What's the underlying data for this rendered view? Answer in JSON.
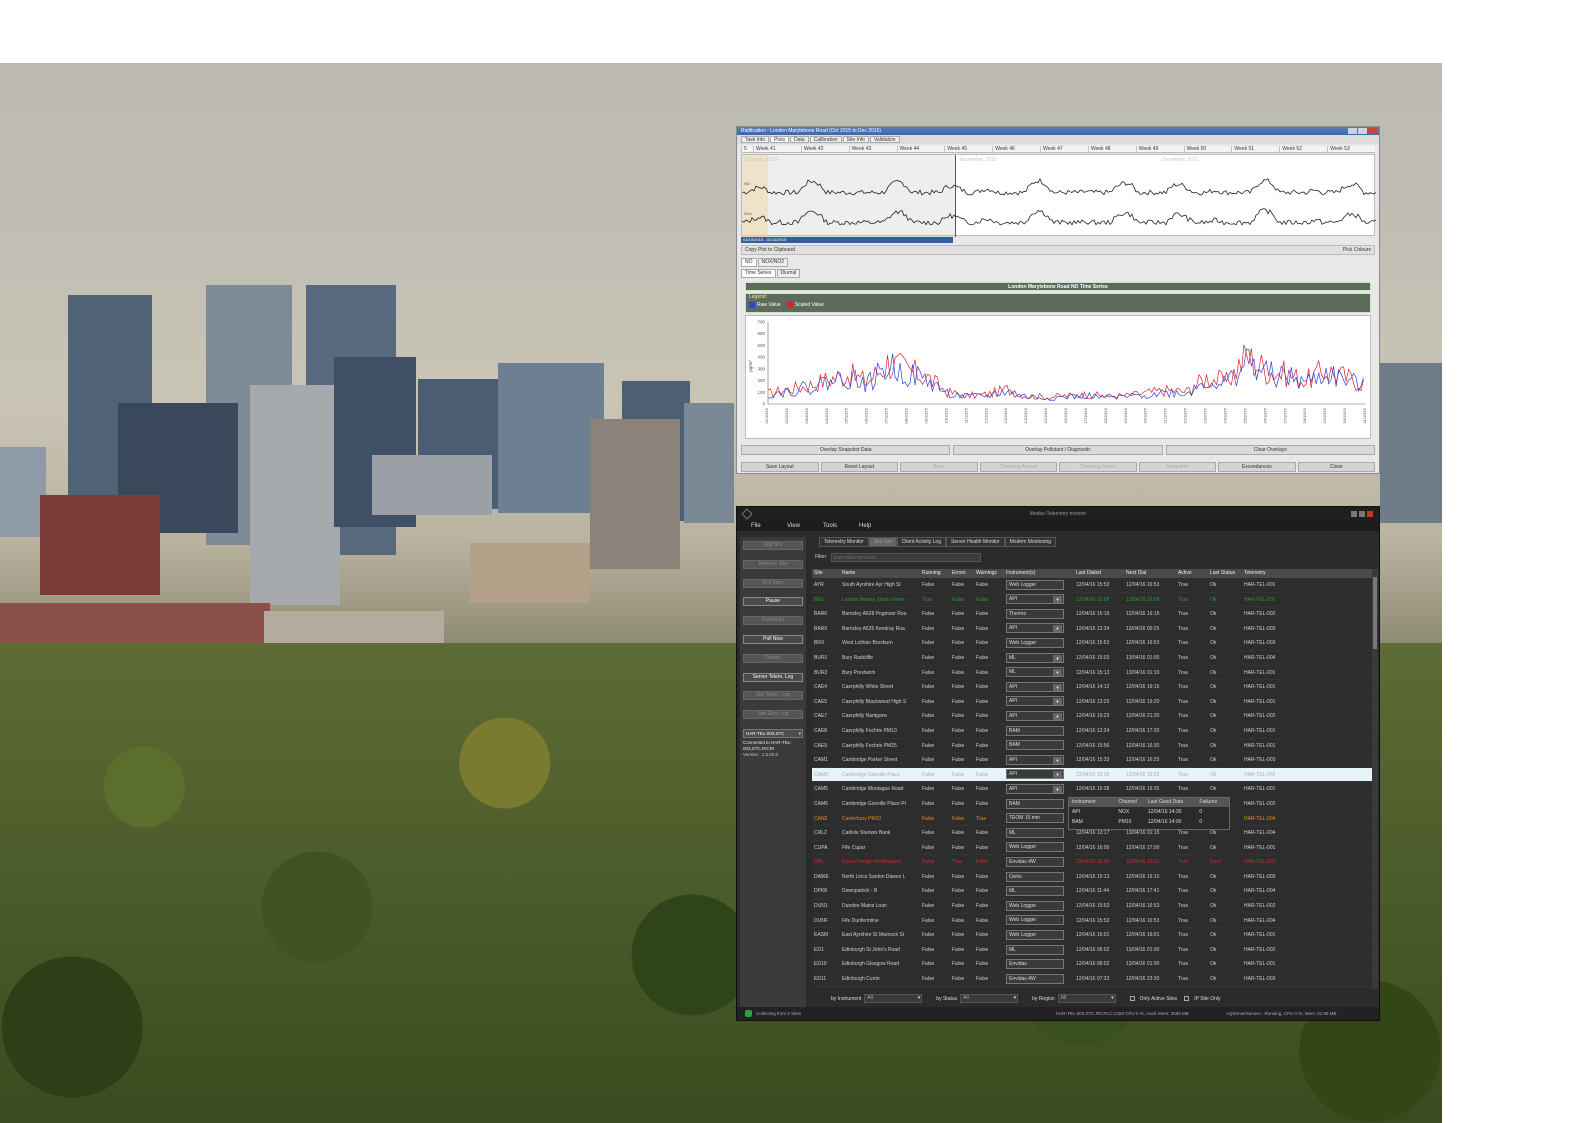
{
  "top_window": {
    "title": "Ratification - London Marylebone Road (Oct 2015 to Dec 2015)",
    "tabs": [
      "Task Info",
      "Plots",
      "Data",
      "Calibration",
      "Site Info",
      "Validation"
    ],
    "active_tab": "Plots",
    "weeks": [
      "Week 41",
      "Week 42",
      "Week 43",
      "Week 44",
      "Week 45",
      "Week 46",
      "Week 47",
      "Week 48",
      "Week 49",
      "Week 50",
      "Week 51",
      "Week 52",
      "Week 53"
    ],
    "week_start": "5",
    "months": [
      "October, 2015",
      "November, 2015",
      "December, 2015"
    ],
    "overview_labels": [
      "NO",
      "NOx"
    ],
    "selected_range": "01/10/2015 - 01/11/2015",
    "copy_plot": "Copy Plot to Clipboard",
    "pick_colours": "Pick Colours",
    "pollutant_tabs": [
      "NO",
      "NOX/NO2"
    ],
    "series_tabs": [
      "Time Series",
      "Diurnal"
    ],
    "chart_title": "London Marylebone Road NO Time Series",
    "legend_title": "Legend:",
    "legend_items": [
      {
        "name": "Raw Value",
        "color": "#2b46d6"
      },
      {
        "name": "Scaled Value",
        "color": "#e0202a"
      }
    ],
    "y_axis_label": "µg/m³",
    "buttons_row1": [
      "Overlay Snapshot Data",
      "Overlay Pollutant / Diagnostic",
      "Clear Overlays"
    ],
    "buttons_row2": [
      "Save Layout",
      "Reset Layout",
      "Save",
      "Checking Accept",
      "Checking Reject",
      "Snapshot",
      "Exceedances",
      "Close"
    ],
    "buttons_row2_disabled": [
      false,
      false,
      true,
      true,
      true,
      true,
      false,
      false
    ]
  },
  "chart_data": {
    "type": "line",
    "title": "London Marylebone Road NO Time Series",
    "ylabel": "µg/m³",
    "ylim": [
      0,
      700
    ],
    "y_ticks": [
      0,
      100,
      200,
      300,
      400,
      500,
      600,
      700
    ],
    "x": [
      "01/10/15",
      "02/10/15",
      "03/10/15",
      "04/10/15",
      "05/10/15",
      "06/10/15",
      "07/10/15",
      "08/10/15",
      "09/10/15",
      "10/10/15",
      "11/10/15",
      "12/10/15",
      "13/10/15",
      "14/10/15",
      "15/10/15",
      "16/10/15",
      "17/10/15",
      "18/10/15",
      "19/10/15",
      "20/10/15",
      "21/10/15",
      "22/10/15",
      "23/10/15",
      "24/10/15",
      "25/10/15",
      "26/10/15",
      "27/10/15",
      "28/10/15",
      "29/10/15",
      "30/10/15",
      "31/10/15"
    ],
    "series": [
      {
        "name": "Raw Value",
        "color": "#2b46d6",
        "values": [
          80,
          110,
          140,
          190,
          230,
          170,
          320,
          260,
          200,
          90,
          60,
          70,
          110,
          60,
          50,
          60,
          70,
          55,
          60,
          80,
          100,
          90,
          200,
          170,
          370,
          260,
          230,
          180,
          260,
          200,
          150
        ]
      },
      {
        "name": "Scaled Value",
        "color": "#e0202a",
        "values": [
          90,
          125,
          155,
          210,
          255,
          190,
          355,
          290,
          225,
          100,
          70,
          80,
          125,
          70,
          60,
          70,
          80,
          65,
          70,
          95,
          115,
          105,
          225,
          190,
          410,
          290,
          255,
          200,
          290,
          225,
          170
        ]
      }
    ]
  },
  "monitor": {
    "title": "Modus-Telemetry monitor",
    "menu": [
      "File",
      "View",
      "Tools",
      "Help"
    ],
    "side_buttons": [
      {
        "label": "Add Site",
        "enabled": false
      },
      {
        "label": "Remove Site",
        "enabled": false
      },
      {
        "label": "Poll Sites",
        "enabled": false
      },
      {
        "label": "Pause",
        "enabled": true
      },
      {
        "label": "Download",
        "enabled": false
      },
      {
        "label": "Poll Now",
        "enabled": true
      },
      {
        "label": "Details",
        "enabled": false
      },
      {
        "label": "Server Telem. Log",
        "enabled": true
      },
      {
        "label": "Site Telem. Log",
        "enabled": false
      },
      {
        "label": "Site Error Log",
        "enabled": false
      }
    ],
    "server_select": "HAR-TEL-003,STC",
    "connected_to": "Connected to HAR-TEL-003,STC,RICRr",
    "version": "Version : 1.3.20.0",
    "tabs": [
      "Telemetry Monitor",
      "Site List",
      "Client Activity Log",
      "Server Health Monitor",
      "Modem Monitoring"
    ],
    "active_tab": "Site List",
    "filter_label": "Filter:",
    "filter_placeholder": "Enter Filter Text Here",
    "columns": [
      "Site",
      "Name",
      "Running",
      "Errors",
      "Warnings",
      "Instrument(s)",
      "Last Dialed",
      "Next Dial",
      "Active",
      "Last Status",
      "Telemetry"
    ],
    "rows": [
      {
        "site": "AYR",
        "name": "South Ayrshire Ayr High St",
        "running": "False",
        "errors": "False",
        "warnings": "False",
        "instrument": "Web Logger",
        "last": "12/04/16 15:53",
        "next": "12/04/16 16:53",
        "active": "True",
        "status": "Ok",
        "tel": "HAR-TEL-001",
        "color": "#d0d0d0",
        "dd": false
      },
      {
        "site": "BEX",
        "name": "London Bexley Slade Green",
        "running": "True",
        "errors": "False",
        "warnings": "False",
        "instrument": "API",
        "last": "12/04/16 16:08",
        "next": "12/04/16 16:08",
        "active": "True",
        "status": "Ok",
        "tel": "HAR-TEL-001",
        "color": "#2e9b2e",
        "dd": true
      },
      {
        "site": "BAR6",
        "name": "Barnsley A628 Pogmoor Roa",
        "running": "False",
        "errors": "False",
        "warnings": "False",
        "instrument": "Thermo",
        "last": "12/04/16 15:16",
        "next": "12/04/16 16:15",
        "active": "True",
        "status": "Ok",
        "tel": "HAR-TEL-002",
        "color": "#d0d0d0",
        "dd": false
      },
      {
        "site": "BAR9",
        "name": "Barnsley A635 Kendray Roa",
        "running": "False",
        "errors": "False",
        "warnings": "False",
        "instrument": "API",
        "last": "12/04/16 12:34",
        "next": "13/04/16 00:25",
        "active": "True",
        "status": "Ok",
        "tel": "HAR-TEL-003",
        "color": "#d0d0d0",
        "dd": true
      },
      {
        "site": "BRX",
        "name": "West Lothian Broxburn",
        "running": "False",
        "errors": "False",
        "warnings": "False",
        "instrument": "Web Logger",
        "last": "12/04/16 15:53",
        "next": "12/04/16 16:53",
        "active": "True",
        "status": "Ok",
        "tel": "HAR-TEL-003",
        "color": "#d0d0d0",
        "dd": false
      },
      {
        "site": "BUR1",
        "name": "Bury Radcliffe",
        "running": "False",
        "errors": "False",
        "warnings": "False",
        "instrument": "ML",
        "last": "12/04/16 15:03",
        "next": "13/04/16 01:00",
        "active": "True",
        "status": "Ok",
        "tel": "HAR-TEL-004",
        "color": "#d0d0d0",
        "dd": true
      },
      {
        "site": "BUR2",
        "name": "Bury Prestwich",
        "running": "False",
        "errors": "False",
        "warnings": "False",
        "instrument": "ML",
        "last": "12/04/16 15:13",
        "next": "13/04/16 01:10",
        "active": "True",
        "status": "Ok",
        "tel": "HAR-TEL-001",
        "color": "#d0d0d0",
        "dd": true
      },
      {
        "site": "CAE4",
        "name": "Caerphilly White Street",
        "running": "False",
        "errors": "False",
        "warnings": "False",
        "instrument": "API",
        "last": "12/04/16 14:12",
        "next": "12/04/16 19:15",
        "active": "True",
        "status": "Ok",
        "tel": "HAR-TEL-001",
        "color": "#d0d0d0",
        "dd": true
      },
      {
        "site": "CAE5",
        "name": "Caerphilly Blackwood High S",
        "running": "False",
        "errors": "False",
        "warnings": "False",
        "instrument": "API",
        "last": "12/04/16 13:25",
        "next": "12/04/16 19:20",
        "active": "True",
        "status": "Ok",
        "tel": "HAR-TEL-001",
        "color": "#d0d0d0",
        "dd": true
      },
      {
        "site": "CAE7",
        "name": "Caerphilly Nantgarw",
        "running": "False",
        "errors": "False",
        "warnings": "False",
        "instrument": "API",
        "last": "12/04/16 10:23",
        "next": "12/04/16 21:20",
        "active": "True",
        "status": "Ok",
        "tel": "HAR-TEL-002",
        "color": "#d0d0d0",
        "dd": true
      },
      {
        "site": "CAE8",
        "name": "Caerphilly Fochrie PM10",
        "running": "False",
        "errors": "False",
        "warnings": "False",
        "instrument": "BAM",
        "last": "12/04/16 12:24",
        "next": "12/04/16 17:20",
        "active": "True",
        "status": "Ok",
        "tel": "HAR-TEL-001",
        "color": "#d0d0d0",
        "dd": false
      },
      {
        "site": "CAE9",
        "name": "Caerphilly Fochrie PM25",
        "running": "False",
        "errors": "False",
        "warnings": "False",
        "instrument": "BAM",
        "last": "12/04/16 15:56",
        "next": "12/04/16 16:30",
        "active": "True",
        "status": "Ok",
        "tel": "HAR-TEL-001",
        "color": "#d0d0d0",
        "dd": false
      },
      {
        "site": "CAM1",
        "name": "Cambridge Parker Street",
        "running": "False",
        "errors": "False",
        "warnings": "False",
        "instrument": "API",
        "last": "12/04/16 15:33",
        "next": "12/04/16 16:25",
        "active": "True",
        "status": "Ok",
        "tel": "HAR-TEL-003",
        "color": "#d0d0d0",
        "dd": true
      },
      {
        "site": "CAM3",
        "name": "Cambridge Gonville Place",
        "running": "False",
        "errors": "False",
        "warnings": "False",
        "instrument": "API",
        "last": "12/04/16 15:35",
        "next": "12/04/16 16:25",
        "active": "True",
        "status": "Ok",
        "tel": "HAR-TEL-002",
        "color": "#aab",
        "dd": true,
        "hl": true
      },
      {
        "site": "CAM5",
        "name": "Cambridge Montague Road",
        "running": "False",
        "errors": "False",
        "warnings": "False",
        "instrument": "API",
        "last": "12/04/16 15:38",
        "next": "12/04/16 16:35",
        "active": "True",
        "status": "Ok",
        "tel": "HAR-TEL-001",
        "color": "#d0d0d0",
        "dd": true
      },
      {
        "site": "CAM6",
        "name": "Cambridge Gonville Place PI",
        "running": "False",
        "errors": "False",
        "warnings": "False",
        "instrument": "BAM",
        "last": "",
        "next": "",
        "active": "",
        "status": "",
        "tel": "HAR-TEL-002",
        "color": "#d0d0d0",
        "dd": false
      },
      {
        "site": "CAN2",
        "name": "Canterbury PM10",
        "running": "False",
        "errors": "False",
        "warnings": "True",
        "instrument": "TEOM 15 min",
        "last": "",
        "next": "",
        "active": "",
        "status": "ng",
        "tel": "HAR-TEL-004",
        "color": "#e8921c",
        "dd": false
      },
      {
        "site": "CRL2",
        "name": "Carlisle Stanwix Bank",
        "running": "False",
        "errors": "False",
        "warnings": "False",
        "instrument": "ML",
        "last": "12/04/16 12:17",
        "next": "13/04/16 01:15",
        "active": "True",
        "status": "Ok",
        "tel": "HAR-TEL-004",
        "color": "#d0d0d0",
        "dd": false
      },
      {
        "site": "CUPA",
        "name": "Fife Cupar",
        "running": "False",
        "errors": "False",
        "warnings": "False",
        "instrument": "Web Logger",
        "last": "12/04/16 16:00",
        "next": "12/04/16 17:00",
        "active": "True",
        "status": "Ok",
        "tel": "HAR-TEL-001",
        "color": "#d0d0d0",
        "dd": false
      },
      {
        "site": "DAL",
        "name": "Essex Dengie Rd Mayland",
        "running": "False",
        "errors": "True",
        "warnings": "False",
        "instrument": "Envidas 4W",
        "last": "12/04/16 15:00",
        "next": "12/04/16 16:02",
        "active": "True",
        "status": "Error",
        "tel": "HAR-TEL-001",
        "color": "#d42a2a",
        "dd": false
      },
      {
        "site": "DAWE",
        "name": "North Lincs Santon Dawes L",
        "running": "False",
        "errors": "False",
        "warnings": "False",
        "instrument": "Osiris",
        "last": "12/04/16 15:13",
        "next": "12/04/16 16:10",
        "active": "True",
        "status": "Ok",
        "tel": "HAR-TEL-003",
        "color": "#d0d0d0",
        "dd": false
      },
      {
        "site": "DPK8",
        "name": "Downpatrick - B",
        "running": "False",
        "errors": "False",
        "warnings": "False",
        "instrument": "ML",
        "last": "12/04/16 11:44",
        "next": "12/04/16 17:41",
        "active": "True",
        "status": "Ok",
        "tel": "HAR-TEL-004",
        "color": "#d0d0d0",
        "dd": false
      },
      {
        "site": "DUN1",
        "name": "Dundee Mains Loan",
        "running": "False",
        "errors": "False",
        "warnings": "False",
        "instrument": "Web Logger",
        "last": "12/04/16 15:53",
        "next": "12/04/16 16:53",
        "active": "True",
        "status": "Ok",
        "tel": "HAR-TEL-002",
        "color": "#d0d0d0",
        "dd": false
      },
      {
        "site": "DUNF",
        "name": "Fife Dunfermline",
        "running": "False",
        "errors": "False",
        "warnings": "False",
        "instrument": "Web Logger",
        "last": "12/04/16 15:53",
        "next": "12/04/16 16:53",
        "active": "True",
        "status": "Ok",
        "tel": "HAR-TEL-004",
        "color": "#d0d0d0",
        "dd": false
      },
      {
        "site": "EASM",
        "name": "East Ayrshire St Marnock St",
        "running": "False",
        "errors": "False",
        "warnings": "False",
        "instrument": "Web Logger",
        "last": "12/04/16 15:01",
        "next": "12/04/16 16:01",
        "active": "True",
        "status": "Ok",
        "tel": "HAR-TEL-001",
        "color": "#d0d0d0",
        "dd": false
      },
      {
        "site": "ED1",
        "name": "Edinburgh St John's Road",
        "running": "False",
        "errors": "False",
        "warnings": "False",
        "instrument": "ML",
        "last": "12/04/16 06:02",
        "next": "13/04/16 01:00",
        "active": "True",
        "status": "Ok",
        "tel": "HAR-TEL-002",
        "color": "#d0d0d0",
        "dd": false
      },
      {
        "site": "ED10",
        "name": "Edinburgh Glasgow Road",
        "running": "False",
        "errors": "False",
        "warnings": "False",
        "instrument": "Envidas",
        "last": "12/04/16 06:02",
        "next": "13/04/16 01:00",
        "active": "True",
        "status": "Ok",
        "tel": "HAR-TEL-001",
        "color": "#d0d0d0",
        "dd": false
      },
      {
        "site": "ED11",
        "name": "Edinburgh Currie",
        "running": "False",
        "errors": "False",
        "warnings": "False",
        "instrument": "Envidas 4W",
        "last": "12/04/16 07:33",
        "next": "12/04/16 23:30",
        "active": "True",
        "status": "Ok",
        "tel": "HAR-TEL-003",
        "color": "#d0d0d0",
        "dd": false
      }
    ],
    "popup": {
      "columns": [
        "Instrument",
        "Channel",
        "Last Good Data",
        "Failures"
      ],
      "rows": [
        [
          "API",
          "NOX",
          "12/04/16 14:30",
          "0"
        ],
        [
          "BAM",
          "PM10",
          "12/04/16 14:00",
          "0"
        ]
      ]
    },
    "footer": {
      "by_instrument": "by Instrument",
      "instrument_value": "All",
      "by_status": "by Status",
      "status_value": "All",
      "by_region": "by Region",
      "region_value": "All",
      "only_active": "Only Active Sites",
      "ip_only": "IP Site Only"
    },
    "status_left": "Collecting from 2 Sites",
    "status_right1": "HAR-TEL-003.STC.RICPLC.COM CPU 0 %, Avail. Mem: 3559 MB",
    "status_right2": "AQServerService : Running, CPU 0 %, Mem: 81.56 MB"
  }
}
